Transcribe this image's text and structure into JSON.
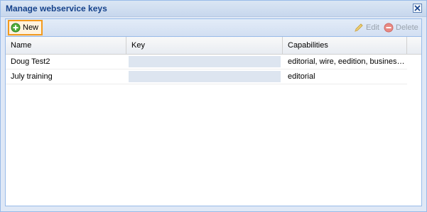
{
  "window": {
    "title": "Manage webservice keys",
    "close_icon": "close-icon"
  },
  "toolbar": {
    "new_label": "New",
    "new_icon": "add-circle-icon",
    "edit_label": "Edit",
    "edit_icon": "pencil-icon",
    "delete_label": "Delete",
    "delete_icon": "remove-circle-icon"
  },
  "grid": {
    "columns": [
      "Name",
      "Key",
      "Capabilities"
    ],
    "rows": [
      {
        "name": "Doug Test2",
        "key": "",
        "capabilities": "editorial, wire, eedition, busines…"
      },
      {
        "name": "July training",
        "key": "",
        "capabilities": "editorial"
      }
    ]
  },
  "colors": {
    "title": "#15428b",
    "border": "#99bbe8",
    "highlight": "#f39a1e"
  }
}
